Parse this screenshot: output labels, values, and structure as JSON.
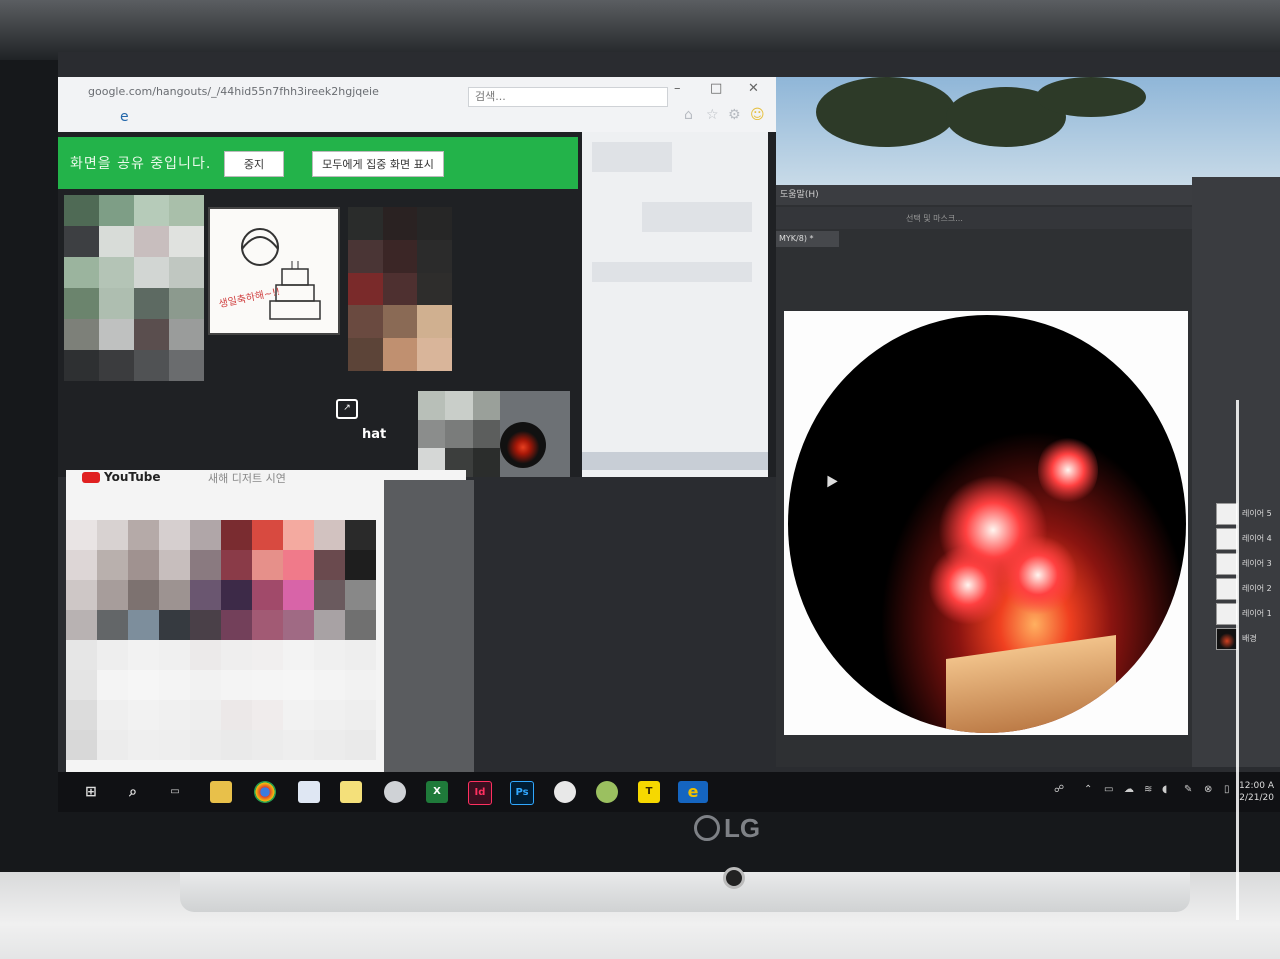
{
  "browser": {
    "url": "google.com/hangouts/_/44hid55n7fhh3ireek2hgjqeie",
    "search_placeholder": "검색..."
  },
  "share_bar": {
    "message": "화면을 공유 중입니다.",
    "stop_label": "중지",
    "present_label": "모두에게 집중 화면 표시"
  },
  "cake_tile": {
    "caption": "생일축하해~!!"
  },
  "chat": {
    "label": "hat"
  },
  "youtube": {
    "title": "YouTube",
    "subtitle": "새해 디저트 시연"
  },
  "photoshop": {
    "menu_label": "도움말(H)",
    "doc_tab": "MYK/8) *",
    "options_label": "선택 및 마스크...",
    "layers": [
      {
        "name": "레이어 5"
      },
      {
        "name": "레이어 4"
      },
      {
        "name": "레이어 3"
      },
      {
        "name": "레이어 2"
      },
      {
        "name": "레이어 1"
      },
      {
        "name": "배경"
      }
    ]
  },
  "taskbar": {
    "time": "12:00 A",
    "date": "2/21/20"
  },
  "device": {
    "brand": "LG"
  }
}
